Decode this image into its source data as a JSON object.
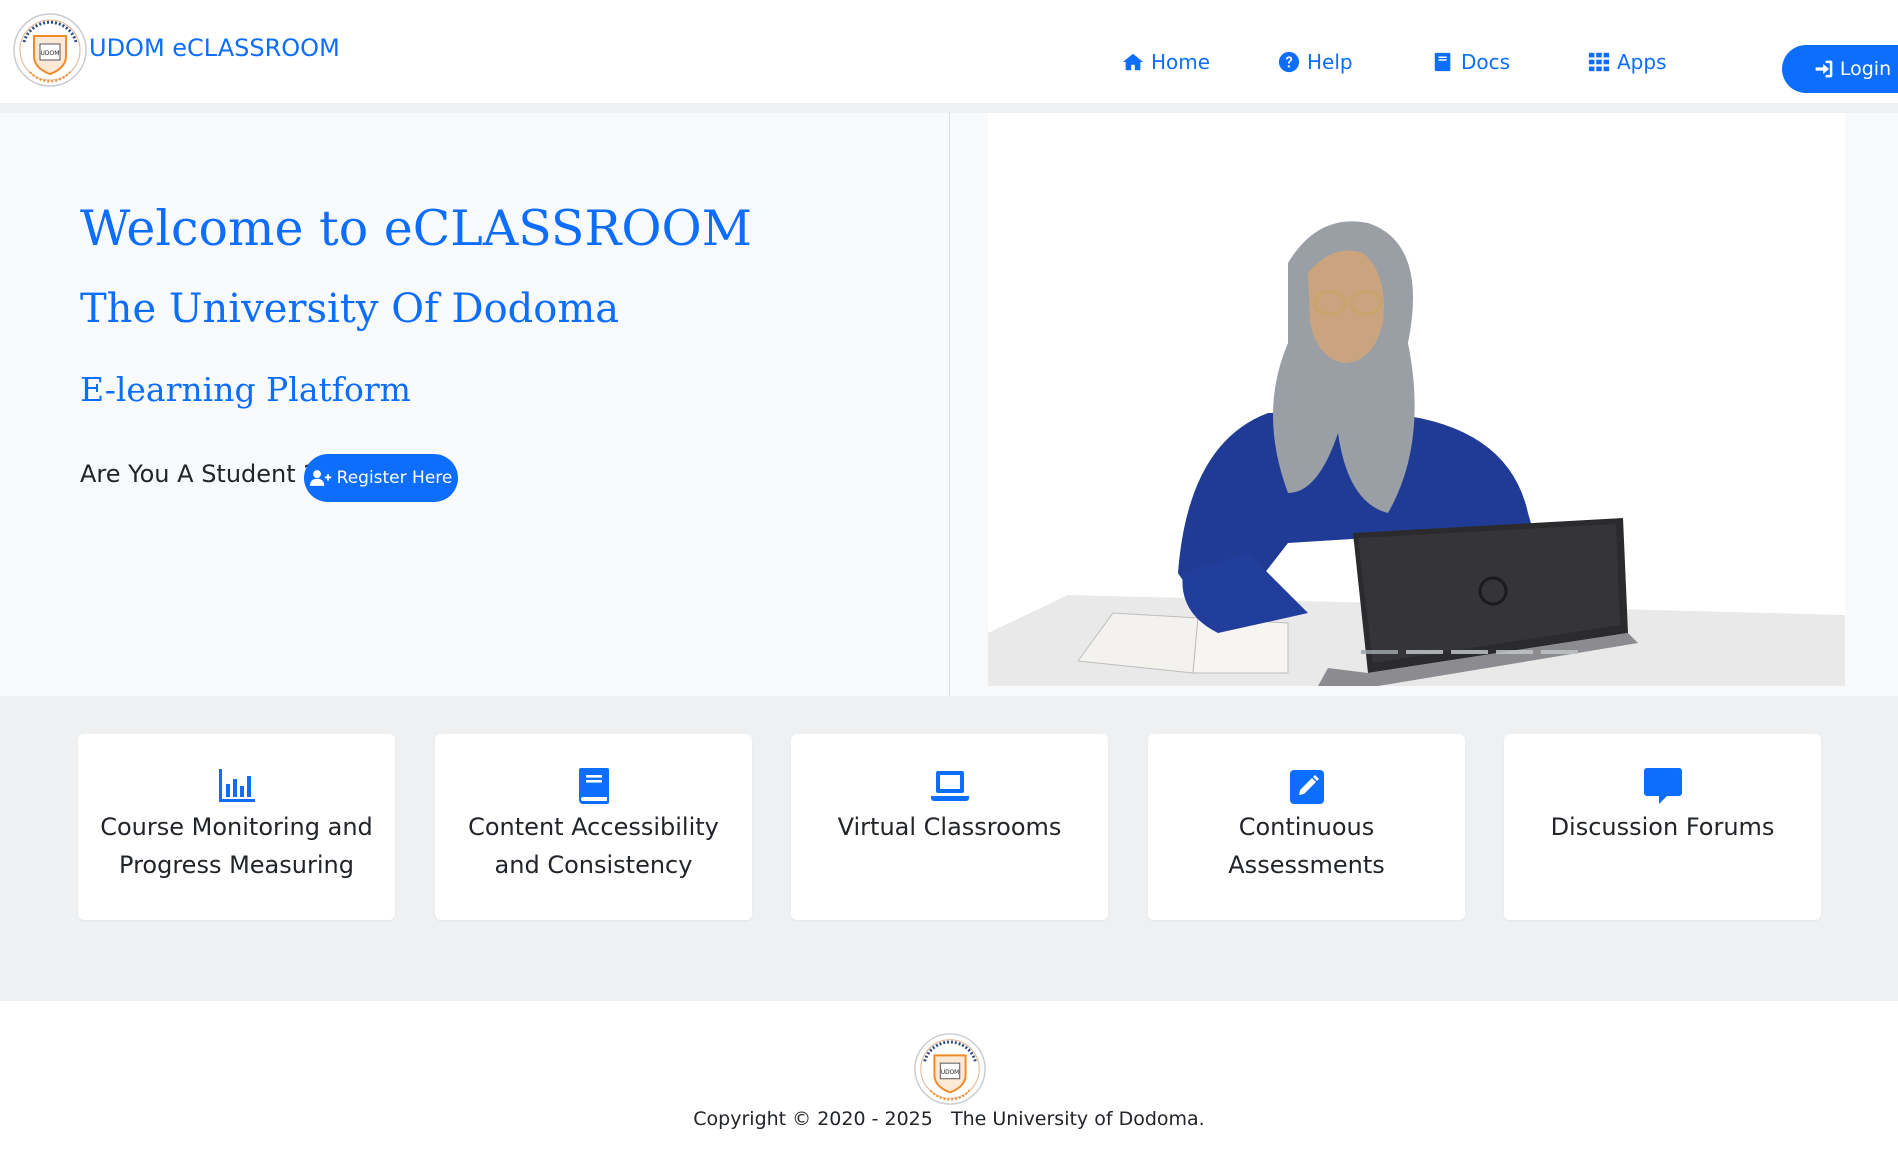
{
  "header": {
    "brand": "UDOM eCLASSROOM",
    "nav": [
      {
        "label": "Home",
        "icon": "home-icon"
      },
      {
        "label": "Help",
        "icon": "question-circle-icon"
      },
      {
        "label": "Docs",
        "icon": "book-icon"
      },
      {
        "label": "Apps",
        "icon": "grid-icon"
      }
    ],
    "login_label": "Login"
  },
  "hero": {
    "title": "Welcome to eCLASSROOM",
    "subtitle": "The University Of Dodoma",
    "tagline": "E-learning Platform",
    "student_prompt": "Are You A Student ?",
    "register_label": "Register Here",
    "carousel_slides": 5,
    "active_slide": 1
  },
  "features": [
    {
      "icon": "bar-chart-icon",
      "lines": [
        "Course Monitoring and",
        "Progress Measuring"
      ]
    },
    {
      "icon": "book-icon",
      "lines": [
        "Content Accessibility",
        "and Consistency"
      ]
    },
    {
      "icon": "laptop-icon",
      "lines": [
        "Virtual Classrooms"
      ]
    },
    {
      "icon": "edit-icon",
      "lines": [
        "Continuous",
        "Assessments"
      ]
    },
    {
      "icon": "chat-icon",
      "lines": [
        "Discussion Forums"
      ]
    }
  ],
  "footer": {
    "copyright": "Copyright © 2020 - 2025   The University of Dodoma."
  },
  "colors": {
    "accent": "#0d6efd",
    "page_gray": "#eef0f2",
    "hero_bg": "#f9fafb",
    "card_bg": "#ffffff"
  }
}
